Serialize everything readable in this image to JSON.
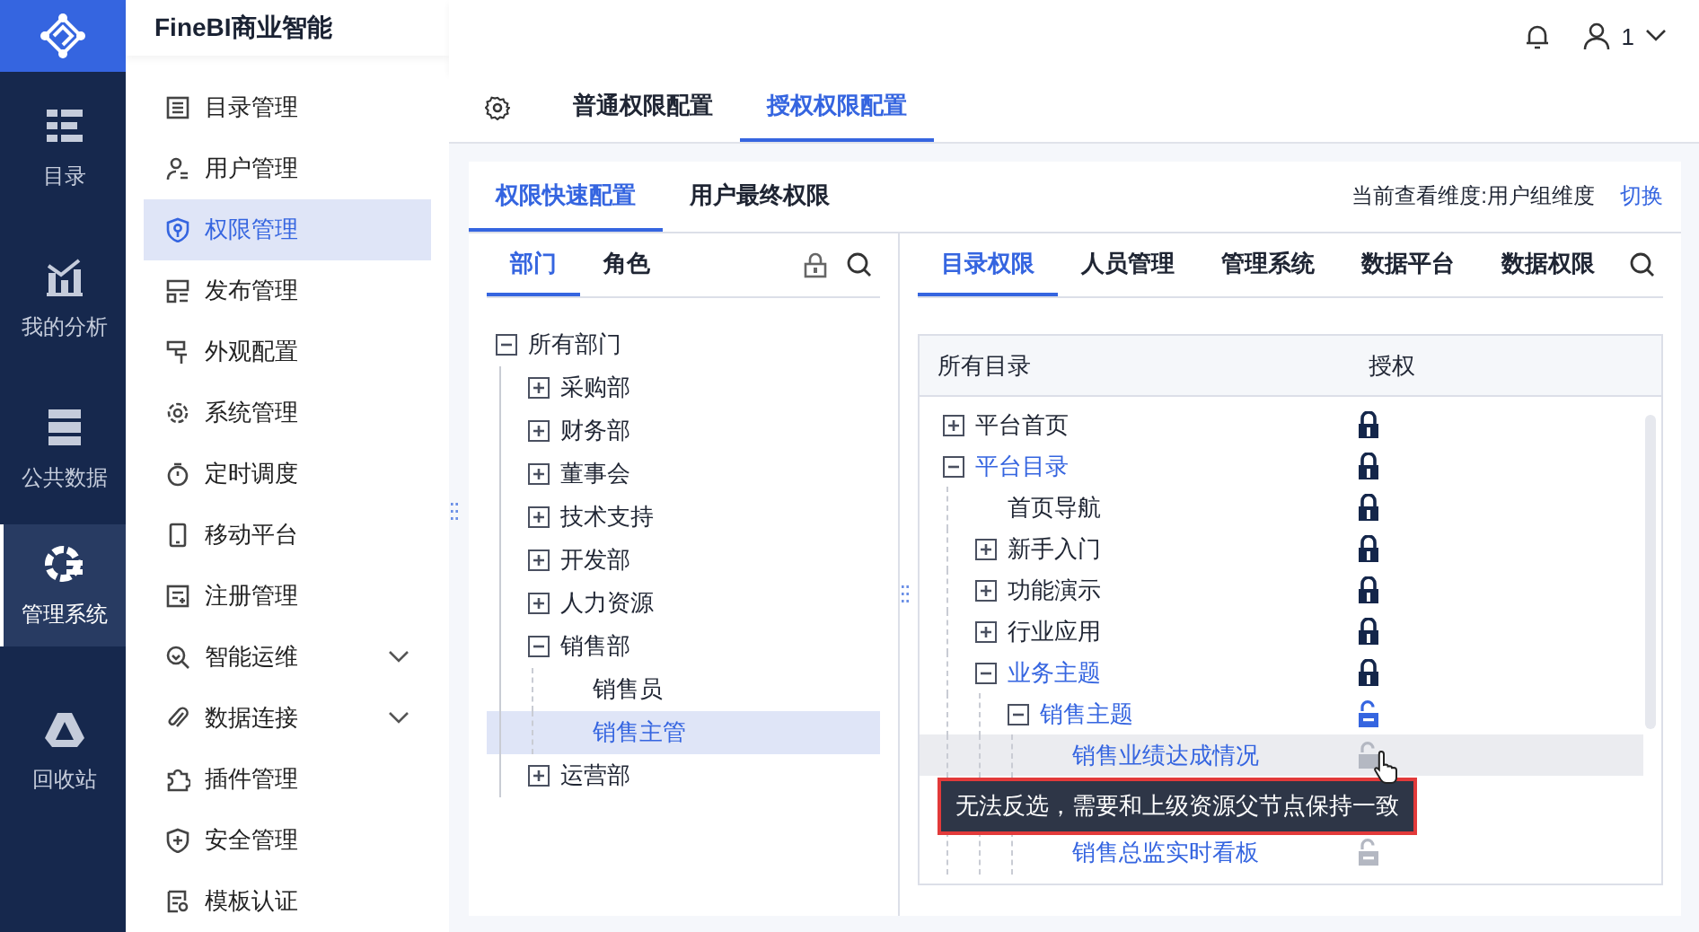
{
  "app": {
    "title": "FineBI商业智能",
    "user": "1"
  },
  "rail": [
    {
      "label": "目录",
      "selected": false
    },
    {
      "label": "我的分析",
      "selected": false
    },
    {
      "label": "公共数据",
      "selected": false
    },
    {
      "label": "管理系统",
      "selected": true
    },
    {
      "label": "回收站",
      "selected": false
    }
  ],
  "nav": [
    {
      "label": "目录管理",
      "selected": false,
      "has_submenu": false
    },
    {
      "label": "用户管理",
      "selected": false,
      "has_submenu": false
    },
    {
      "label": "权限管理",
      "selected": true,
      "has_submenu": false
    },
    {
      "label": "发布管理",
      "selected": false,
      "has_submenu": false
    },
    {
      "label": "外观配置",
      "selected": false,
      "has_submenu": false
    },
    {
      "label": "系统管理",
      "selected": false,
      "has_submenu": false
    },
    {
      "label": "定时调度",
      "selected": false,
      "has_submenu": false
    },
    {
      "label": "移动平台",
      "selected": false,
      "has_submenu": false
    },
    {
      "label": "注册管理",
      "selected": false,
      "has_submenu": false
    },
    {
      "label": "智能运维",
      "selected": false,
      "has_submenu": true
    },
    {
      "label": "数据连接",
      "selected": false,
      "has_submenu": true
    },
    {
      "label": "插件管理",
      "selected": false,
      "has_submenu": false
    },
    {
      "label": "安全管理",
      "selected": false,
      "has_submenu": false
    },
    {
      "label": "模板认证",
      "selected": false,
      "has_submenu": false
    }
  ],
  "top_tabs": [
    {
      "label": "普通权限配置",
      "selected": false
    },
    {
      "label": "授权权限配置",
      "selected": true
    }
  ],
  "mode_tabs": [
    {
      "label": "权限快速配置",
      "selected": true
    },
    {
      "label": "用户最终权限",
      "selected": false
    }
  ],
  "dimension": {
    "text": "当前查看维度:用户组维度",
    "link": "切换"
  },
  "subject_tabs": [
    {
      "label": "部门",
      "selected": true
    },
    {
      "label": "角色",
      "selected": false
    }
  ],
  "departments": [
    {
      "label": "所有部门",
      "expanded": true,
      "selected": false,
      "children": [
        {
          "label": "采购部",
          "expanded": false,
          "selected": false
        },
        {
          "label": "财务部",
          "expanded": false,
          "selected": false
        },
        {
          "label": "董事会",
          "expanded": false,
          "selected": false
        },
        {
          "label": "技术支持",
          "expanded": false,
          "selected": false
        },
        {
          "label": "开发部",
          "expanded": false,
          "selected": false
        },
        {
          "label": "人力资源",
          "expanded": false,
          "selected": false
        },
        {
          "label": "销售部",
          "expanded": true,
          "selected": false,
          "children": [
            {
              "label": "销售员",
              "selected": false
            },
            {
              "label": "销售主管",
              "selected": true
            }
          ]
        },
        {
          "label": "运营部",
          "expanded": false,
          "selected": false
        }
      ]
    }
  ],
  "resource_tabs": [
    {
      "label": "目录权限",
      "selected": true
    },
    {
      "label": "人员管理",
      "selected": false
    },
    {
      "label": "管理系统",
      "selected": false
    },
    {
      "label": "数据平台",
      "selected": false
    },
    {
      "label": "数据权限",
      "selected": false
    }
  ],
  "catalog": {
    "columns": [
      "所有目录",
      "授权"
    ],
    "rows": [
      {
        "label": "平台首页",
        "expanded": false,
        "active": false,
        "locked": true,
        "partial": false,
        "disabled": false,
        "hovered": false
      },
      {
        "label": "平台目录",
        "expanded": true,
        "active": true,
        "locked": true,
        "partial": false,
        "disabled": false,
        "hovered": false,
        "children": [
          {
            "label": "首页导航",
            "active": false,
            "locked": true,
            "partial": false,
            "disabled": false,
            "hovered": false
          },
          {
            "label": "新手入门",
            "expanded": false,
            "active": false,
            "locked": true,
            "partial": false,
            "disabled": false,
            "hovered": false
          },
          {
            "label": "功能演示",
            "expanded": false,
            "active": false,
            "locked": true,
            "partial": false,
            "disabled": false,
            "hovered": false
          },
          {
            "label": "行业应用",
            "expanded": false,
            "active": false,
            "locked": true,
            "partial": false,
            "disabled": false,
            "hovered": false
          },
          {
            "label": "业务主题",
            "expanded": true,
            "active": true,
            "locked": true,
            "partial": false,
            "disabled": false,
            "hovered": false,
            "children": [
              {
                "label": "销售主题",
                "expanded": true,
                "active": true,
                "locked": false,
                "partial": true,
                "disabled": false,
                "hovered": false,
                "children": [
                  {
                    "label": "销售业绩达成情况",
                    "active": true,
                    "locked": false,
                    "partial": false,
                    "disabled": true,
                    "hovered": true
                  },
                  {
                    "label": "销售总监实时看板",
                    "active": true,
                    "locked": false,
                    "partial": true,
                    "disabled": true,
                    "hovered": false
                  }
                ]
              }
            ]
          }
        ]
      }
    ]
  },
  "tooltip": "无法反选，需要和上级资源父节点保持一致"
}
